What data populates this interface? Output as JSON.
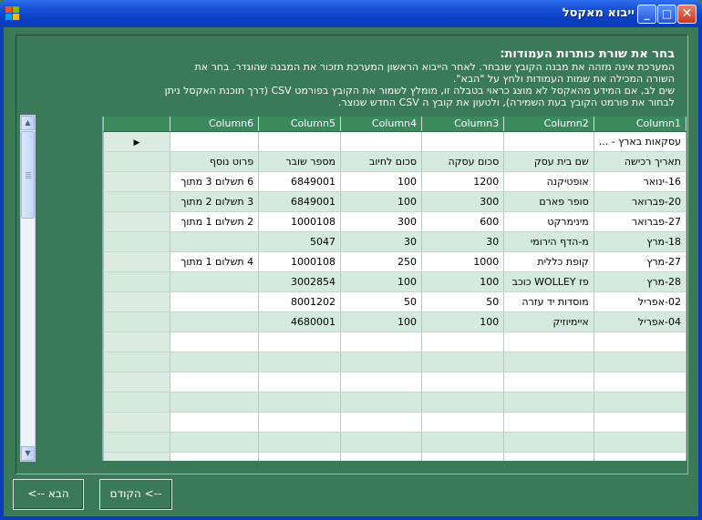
{
  "window": {
    "title": "ייבוא מאקסל"
  },
  "instructions": {
    "title": "בחר את שורת כותרות העמודות:",
    "lines": [
      "המערכת אינה מזהה את מבנה הקובץ שנבחר. לאחר הייבוא הראשון המערכת תזכור את המבנה שהוגדר. בחר את",
      "השורה המכילה את שמות העמודות ולחץ על \"הבא\".",
      "שים לב, אם המידע מהאקסל לא מוצג כראוי בטבלה זו, מומלץ לשמור את הקובץ בפורמט CSV (דרך תוכנת האקסל ניתן",
      "לבחור את פורמט הקובץ בעת השמירה), ולטעון את קובץ ה CSV החדש שנוצר."
    ]
  },
  "grid": {
    "columns": [
      "Column1",
      "Column2",
      "Column3",
      "Column4",
      "Column5",
      "Column6"
    ],
    "rows": [
      {
        "cells": [
          "עסקאות בארץ - ...",
          "",
          "",
          "",
          "",
          ""
        ],
        "current": true
      },
      {
        "cells": [
          "תאריך רכישה",
          "שם בית עסק",
          "סכום עסקה",
          "סכום לחיוב",
          "מספר שובר",
          "פרוט נוסף"
        ]
      },
      {
        "cells": [
          "16-ינואר",
          "אופטיקנה",
          "1200",
          "100",
          "6849001",
          "6 תשלום 3 מתוך"
        ]
      },
      {
        "cells": [
          "20-פברואר",
          "סופר פארם",
          "300",
          "100",
          "6849001",
          "3 תשלום 2 מתוך"
        ]
      },
      {
        "cells": [
          "27-פברואר",
          "מינימרקט",
          "600",
          "300",
          "1000108",
          "2 תשלום 1 מתוך"
        ]
      },
      {
        "cells": [
          "18-מרץ",
          "מ-הדף הירומי",
          "30",
          "30",
          "5047",
          ""
        ]
      },
      {
        "cells": [
          "27-מרץ",
          "קופת כללית",
          "1000",
          "250",
          "1000108",
          "4 תשלום 1 מתוך"
        ]
      },
      {
        "cells": [
          "28-מרץ",
          "פז WOLLEY כוכב",
          "100",
          "100",
          "3002854",
          ""
        ]
      },
      {
        "cells": [
          "02-אפריל",
          "מוסדות יד עזרה",
          "50",
          "50",
          "8001202",
          ""
        ]
      },
      {
        "cells": [
          "04-אפריל",
          "איימיוזיק",
          "100",
          "100",
          "4680001",
          ""
        ]
      },
      {
        "cells": [
          "",
          "",
          "",
          "",
          "",
          ""
        ]
      },
      {
        "cells": [
          "",
          "",
          "",
          "",
          "",
          ""
        ]
      },
      {
        "cells": [
          "",
          "",
          "",
          "",
          "",
          ""
        ]
      },
      {
        "cells": [
          "",
          "",
          "",
          "",
          "",
          ""
        ]
      },
      {
        "cells": [
          "",
          "",
          "",
          "",
          "",
          ""
        ]
      },
      {
        "cells": [
          "",
          "",
          "",
          "",
          "",
          ""
        ]
      },
      {
        "cells": [
          "",
          "",
          "",
          "",
          "",
          ""
        ]
      }
    ]
  },
  "buttons": {
    "next": "הבא  -->",
    "prev": "--> הקודם"
  },
  "icons": {
    "current_row": "triangle-right-icon",
    "scroll_up": "arrow-up-icon",
    "scroll_down": "arrow-down-icon"
  }
}
